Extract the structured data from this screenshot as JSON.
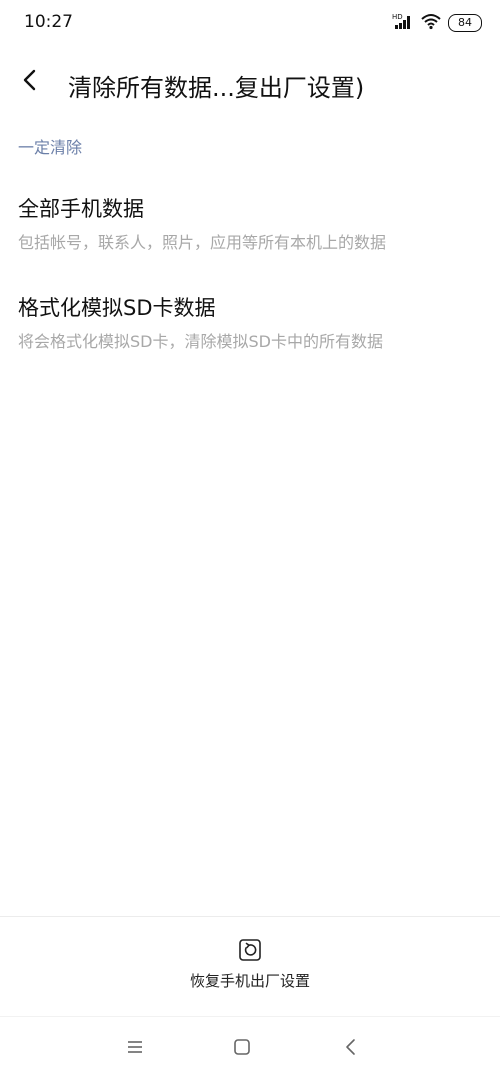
{
  "status_bar": {
    "time": "10:27",
    "network_badge": "HD",
    "battery_level": "84"
  },
  "header": {
    "title": "清除所有数据...复出厂设置)"
  },
  "section": {
    "header": "一定清除",
    "items": [
      {
        "title": "全部手机数据",
        "subtitle": "包括帐号，联系人，照片，应用等所有本机上的数据"
      },
      {
        "title": "格式化模拟SD卡数据",
        "subtitle": "将会格式化模拟SD卡，清除模拟SD卡中的所有数据"
      }
    ]
  },
  "bottom_action": {
    "label": "恢复手机出厂设置",
    "icon": "reset-icon"
  },
  "nav_bar": {
    "icons": [
      "menu-icon",
      "home-icon",
      "back-icon"
    ]
  },
  "colors": {
    "section_header": "#6b7fa8",
    "subtitle": "#a8a8a8"
  }
}
